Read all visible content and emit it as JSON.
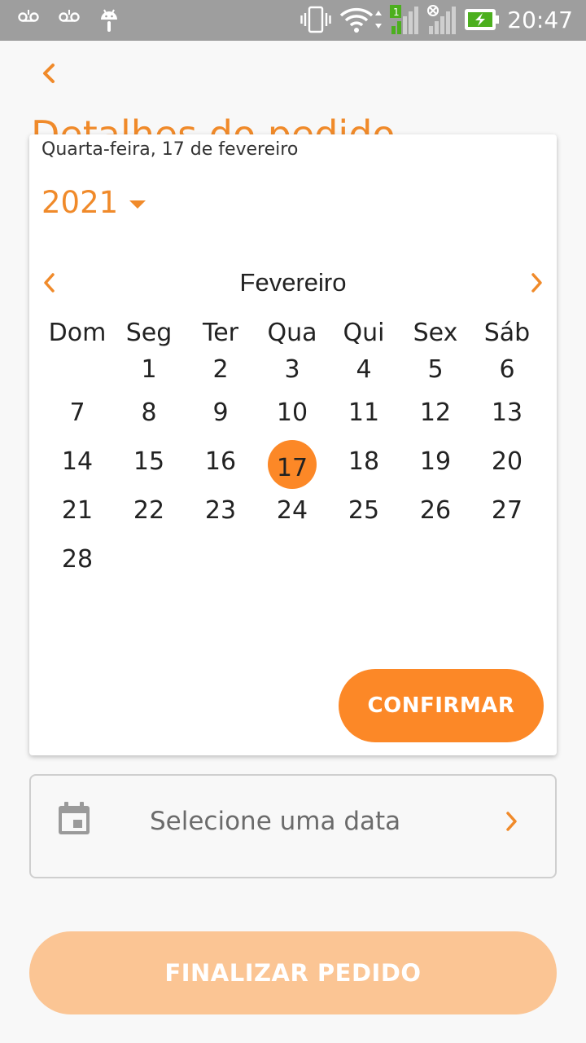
{
  "status_bar": {
    "time": "20:47",
    "signal_badge": "1",
    "icons": [
      "voicemail-icon",
      "voicemail-icon",
      "android-icon",
      "vibrate-icon",
      "wifi-icon",
      "signal-icon",
      "no-signal-icon",
      "battery-charging-icon"
    ]
  },
  "header": {
    "title": "Detalhes do pedido",
    "back_icon": "chevron-left-icon"
  },
  "date_dialog": {
    "selected_date_text": "Quarta-feira, 17 de fevereiro",
    "year": "2021",
    "month": "Fevereiro",
    "weekdays": [
      "Dom",
      "Seg",
      "Ter",
      "Qua",
      "Qui",
      "Sex",
      "Sáb"
    ],
    "selected_day": 17,
    "days": [
      "",
      "1",
      "2",
      "3",
      "4",
      "5",
      "6",
      "7",
      "8",
      "9",
      "10",
      "11",
      "12",
      "13",
      "14",
      "15",
      "16",
      "17",
      "18",
      "19",
      "20",
      "21",
      "22",
      "23",
      "24",
      "25",
      "26",
      "27",
      "28",
      "",
      "",
      "",
      "",
      "",
      ""
    ],
    "confirm_label": "CONFIRMAR"
  },
  "date_field": {
    "placeholder": "Selecione uma data",
    "icon": "calendar-icon"
  },
  "finalize_label": "FINALIZAR PEDIDO",
  "colors": {
    "accent": "#fc8827",
    "accent_text": "#f08a2a",
    "disabled_button": "#fbc594",
    "status_bar": "#9e9e9e"
  }
}
